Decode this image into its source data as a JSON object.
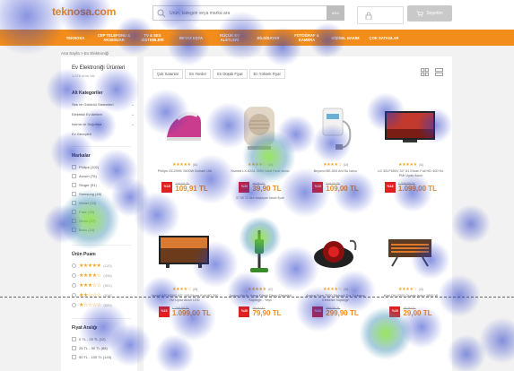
{
  "header": {
    "logo_text": "teknosa.com",
    "search_placeholder": "Ürün, kategori veya marka ara",
    "search_button": "ARA",
    "cart_label": "Sepetim"
  },
  "nav": {
    "items": [
      "TEKNOSA",
      "CEP TELEFONU & AKSESUAR",
      "TV & SES SİSTEMLERİ",
      "BEYAZ EŞYA",
      "KÜÇÜK EV ALETLERİ",
      "BİLGİSAYAR",
      "FOTOĞRAF & KAMERA",
      "KİŞİSEL BAKIM",
      "ÇOK SATANLAR"
    ]
  },
  "breadcrumb": "Ana Sayfa > Ev Elektroniği",
  "sidebar": {
    "title": "Ev Elektroniği Ürünleri",
    "subtitle": "1.076 ürün var",
    "categories_title": "Alt Kategoriler",
    "categories": [
      "Ses ve Görüntü Sistemleri",
      "Elektrikli Ev Aletleri",
      "Isıtma ve Soğutma",
      "Ev Gereçleri"
    ],
    "brands_title": "Markalar",
    "brands": [
      "Philips (102)",
      "Arzum (76)",
      "Singer (51)",
      "Samsung (48)",
      "Vestel (34)",
      "Fakir (33)",
      "Sinbo (27)",
      "Beko (24)"
    ],
    "rating_title": "Ürün Puanı",
    "ratings": [
      {
        "stars": "★★★★★",
        "count": "(120)"
      },
      {
        "stars": "★★★★☆",
        "count": "(436)"
      },
      {
        "stars": "★★★☆☆",
        "count": "(501)"
      },
      {
        "stars": "★★☆☆☆",
        "count": "(518)"
      },
      {
        "stars": "★☆☆☆☆",
        "count": "(520)"
      }
    ],
    "price_title": "Fiyat Aralığı",
    "prices": [
      "0 TL - 25 TL (12)",
      "25 TL - 50 TL (88)",
      "50 TL - 100 TL (143)"
    ]
  },
  "sort_options": [
    "Çok Satanlar",
    "En Yeniler",
    "En Düşük Fiyat",
    "En Yüksek Fiyat"
  ],
  "products": [
    {
      "name": "Philips GC2990/ 2600W Buharlı Ütü",
      "rating": "★★★★★",
      "count": "(82)",
      "discount": "%15",
      "old_price": "129,00 TL",
      "price": "109,91 TL",
      "note": "",
      "color": "#c93c8e",
      "kind": "iron"
    },
    {
      "name": "Kumtel LX-6331 2000 Watt Fanlı Isıtıcı",
      "rating": "★★★★☆",
      "count": "(55)",
      "discount": "%20",
      "old_price": "49,90 TL",
      "price": "39,90 TL",
      "note": "37,90 TL'den başlayan taksit fiyatı",
      "color": "#d9d0c3",
      "kind": "heater"
    },
    {
      "name": "Beyond BE-503 Ani Su Isıtıcı",
      "rating": "★★★★☆",
      "count": "(18)",
      "discount": "%10",
      "old_price": "119,00 TL",
      "price": "109,00 TL",
      "note": "",
      "color": "#e8e8e8",
      "kind": "water"
    },
    {
      "name": "LG 32LF650V 32\" 81 Ekran Full HD 400 Hz. PMI Uydu Alıcılı",
      "rating": "★★★★★",
      "count": "(41)",
      "discount": "%18",
      "old_price": "1.339,00 TL",
      "price": "1.099,00 TL",
      "note": "",
      "color": "#222",
      "kind": "tv"
    },
    {
      "name": "Vestel 43FA5000 43\" 109 Ekran Full HD 200 Hz Uydu Alıcılı LED",
      "rating": "★★★★☆",
      "count": "(28)",
      "discount": "%15",
      "old_price": "1.299,00 TL",
      "price": "1.099,00 TL",
      "note": "",
      "color": "#222",
      "kind": "tv2"
    },
    {
      "name": "Arnica Merlin Hepa Filtreli Dikey Elektrikli Süpürge - Yeşil",
      "rating": "★★★★★",
      "count": "(67)",
      "discount": "%20",
      "old_price": "99,90 TL",
      "price": "79,90 TL",
      "note": "",
      "color": "#3a8a2a",
      "kind": "vacuum"
    },
    {
      "name": "Arnica Pure 7000 Siklonik Toz Torbasız Elektrikli Süpürge",
      "rating": "★★★★☆",
      "count": "(39)",
      "discount": "%20",
      "old_price": "369,00 TL",
      "price": "299,90 TL",
      "note": "",
      "color": "#333",
      "kind": "cyclone"
    },
    {
      "name": "Kiwi QH-2200 Quartz Isıtıcı 1600 W",
      "rating": "★★★★☆",
      "count": "(24)",
      "discount": "%20",
      "old_price": "36,90 TL",
      "price": "29,00 TL",
      "note": "",
      "color": "#b85c1c",
      "kind": "quartz"
    }
  ]
}
